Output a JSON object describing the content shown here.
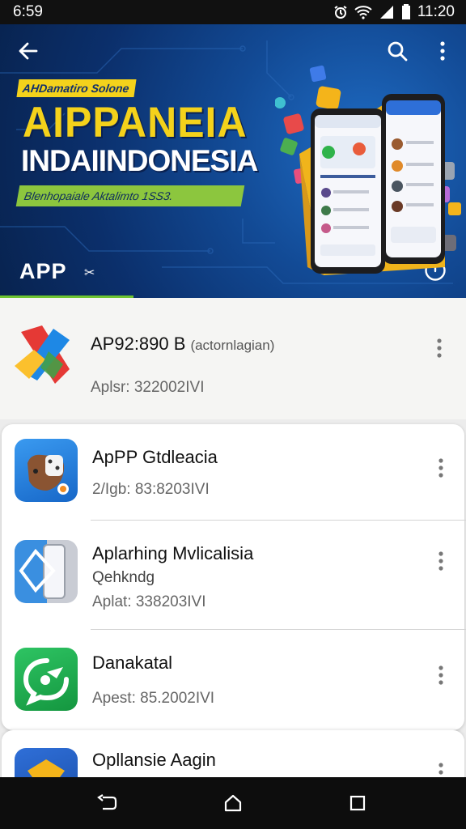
{
  "status_bar": {
    "time": "6:59",
    "clock": "11:20",
    "icons": [
      "alarm-icon",
      "wifi-icon",
      "signal-icon",
      "battery-icon"
    ]
  },
  "hero": {
    "tag_top": "AHDamatiro Solone",
    "title": "AIPPANEIA",
    "subtitle": "INDAIINDONESIA",
    "tag_bottom": "Blenhopaiale Aktalimto 1SS3.",
    "app_label": "APP",
    "app_label_symbol": "✂",
    "colors": {
      "accent_yellow": "#f4d21b",
      "accent_green": "#8cc63e",
      "background": "#0b2f6b"
    }
  },
  "apps": [
    {
      "title": "AP92:890 B",
      "title_note": "(actornlagian)",
      "subtitle": "Aplsr: 322002IVI",
      "icon": "colorful-x-logo-icon"
    },
    {
      "title": "ApPP Gtdleacia",
      "subtitle": "2/Igb: 83:8203IVI",
      "icon": "game-controller-app-icon"
    },
    {
      "title": "Aplarhing Mvlicalisia",
      "secondary": "Qehkndg",
      "subtitle": "Aplat: 338203IVI",
      "icon": "phone-diamond-app-icon"
    },
    {
      "title": "Danakatal",
      "subtitle": "Apest: 85.2002IVI",
      "icon": "green-chat-app-icon"
    },
    {
      "title": "Opllansie Aagin",
      "subtitle": "",
      "icon": "golden-badge-app-icon"
    }
  ]
}
